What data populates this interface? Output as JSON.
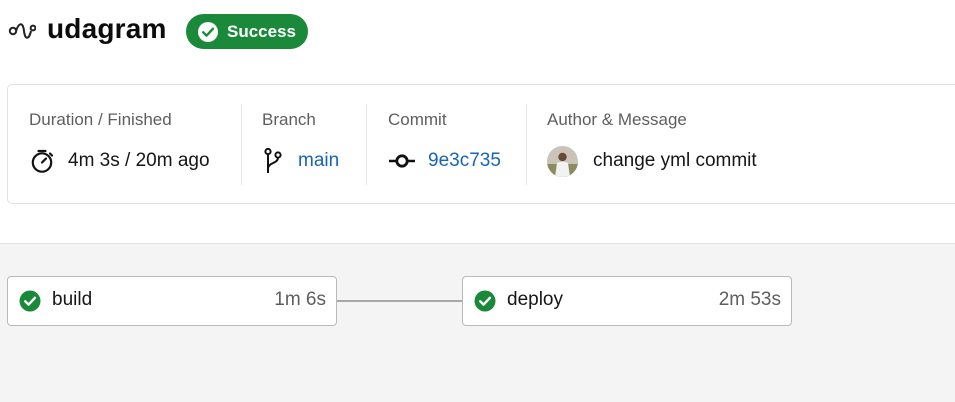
{
  "header": {
    "pipeline_icon": "pipeline-icon",
    "title": "udagram",
    "status": {
      "label": "Success",
      "icon": "check-circle-icon",
      "color": "#1a8a3a"
    }
  },
  "summary": {
    "duration": {
      "label": "Duration / Finished",
      "value": "4m 3s / 20m ago",
      "icon": "stopwatch-icon"
    },
    "branch": {
      "label": "Branch",
      "value": "main",
      "icon": "branch-icon"
    },
    "commit": {
      "label": "Commit",
      "value": "9e3c735",
      "icon": "commit-icon"
    },
    "author": {
      "label": "Author & Message",
      "message": "change yml commit",
      "icon": "avatar"
    }
  },
  "jobs": [
    {
      "name": "build",
      "duration": "1m 6s",
      "status": "success"
    },
    {
      "name": "deploy",
      "duration": "2m 53s",
      "status": "success"
    }
  ],
  "colors": {
    "success": "#1a8a3a",
    "link": "#1764b8",
    "graph_bg": "#f4f4f4"
  }
}
